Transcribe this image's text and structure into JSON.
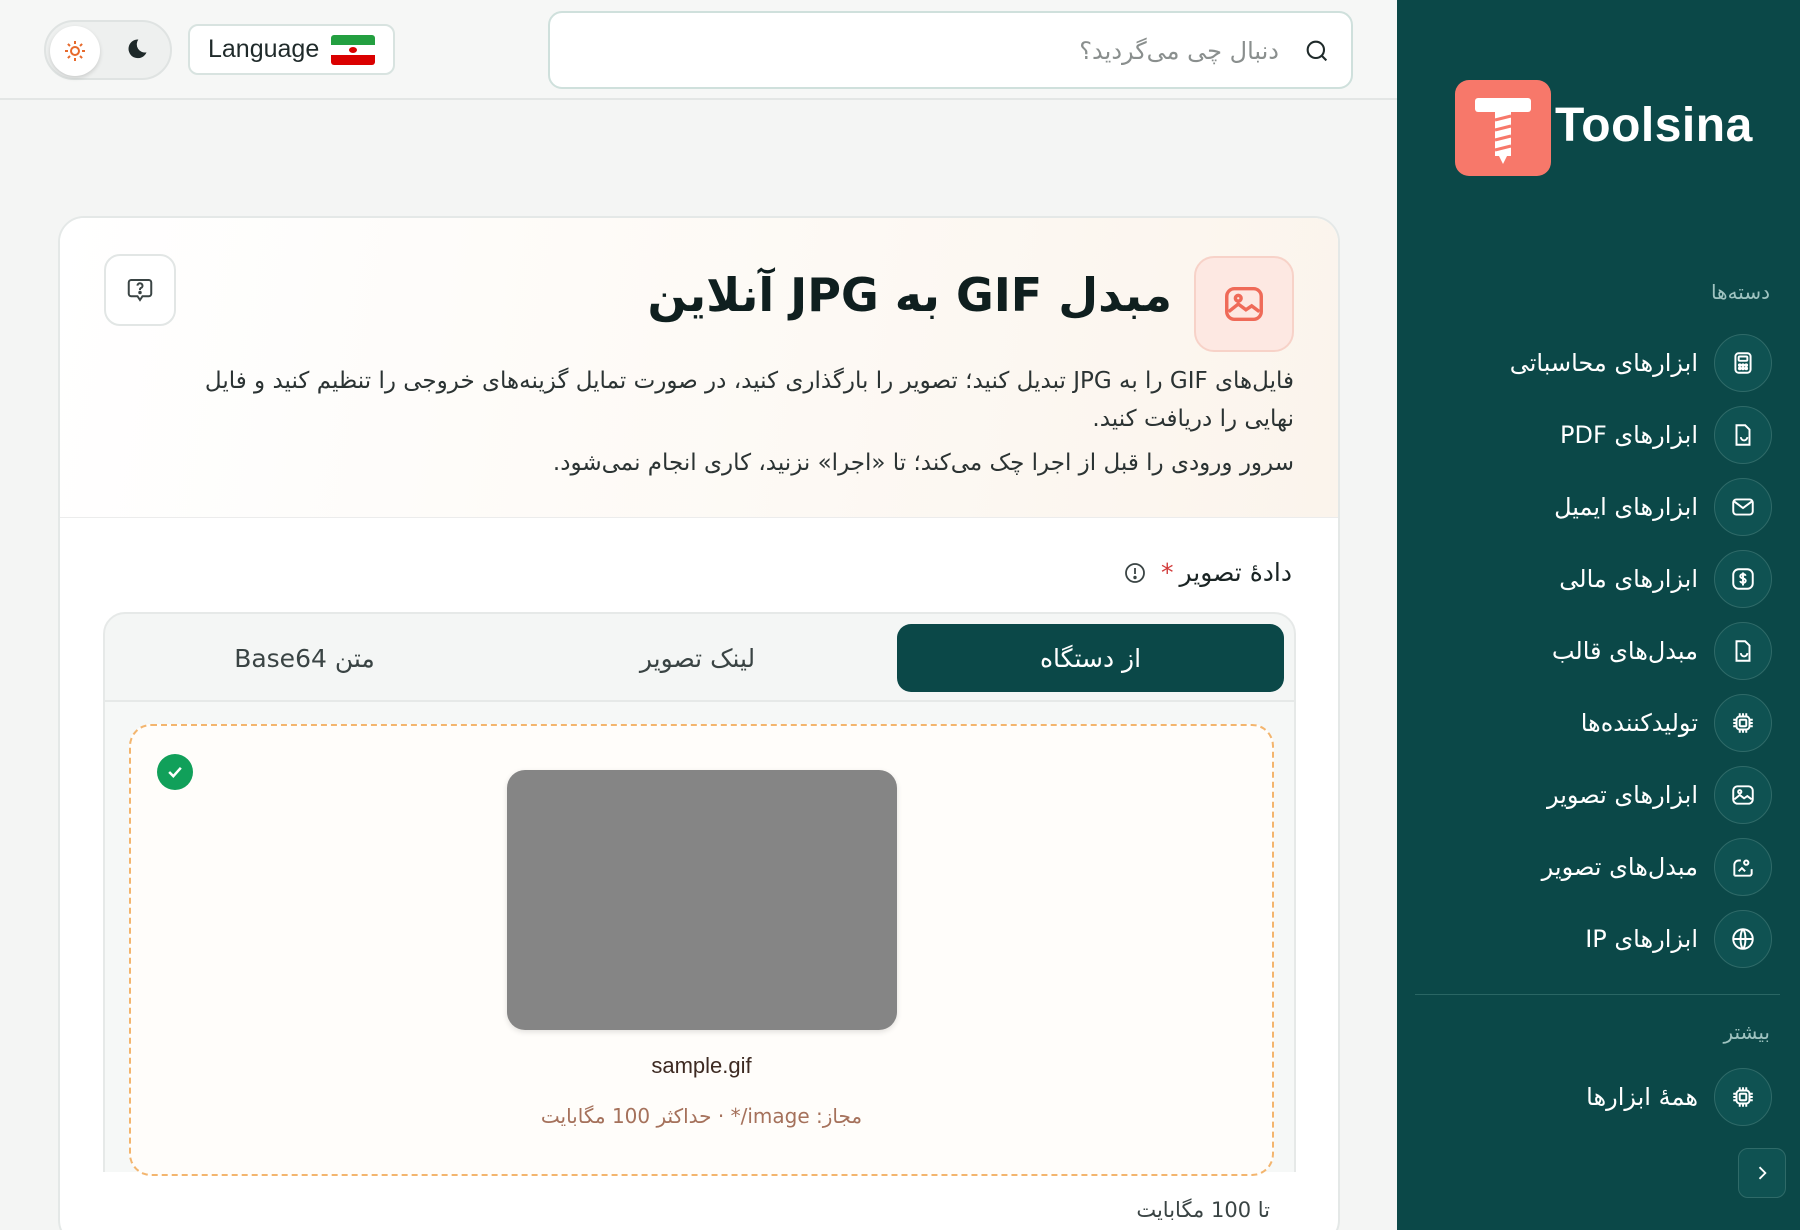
{
  "brand": {
    "name": "Toolsina",
    "accent": "#f7786a",
    "sidebar_bg": "#0b4848"
  },
  "sidebar": {
    "categories_label": "دسته‌ها",
    "items": [
      {
        "label": "ابزارهای محاسباتی",
        "icon": "calculator-icon"
      },
      {
        "label": "ابزارهای PDF",
        "icon": "pdf-file-icon"
      },
      {
        "label": "ابزارهای ایمیل",
        "icon": "mail-icon"
      },
      {
        "label": "ابزارهای مالی",
        "icon": "dollar-icon"
      },
      {
        "label": "مبدل‌های قالب",
        "icon": "file-convert-icon"
      },
      {
        "label": "تولیدکننده‌ها",
        "icon": "chip-icon"
      },
      {
        "label": "ابزارهای تصویر",
        "icon": "image-icon"
      },
      {
        "label": "مبدل‌های تصویر",
        "icon": "image-convert-icon"
      },
      {
        "label": "ابزارهای IP",
        "icon": "globe-icon"
      }
    ],
    "more_label": "بیشتر",
    "more_items": [
      {
        "label": "همهٔ ابزارها",
        "icon": "chip-icon"
      }
    ]
  },
  "topbar": {
    "search_placeholder": "دنبال چی می‌گردید؟",
    "language_label": "Language"
  },
  "page": {
    "title": "مبدل GIF به JPG آنلاین",
    "description": "فایل‌های GIF را به JPG تبدیل کنید؛ تصویر را بارگذاری کنید، در صورت تمایل گزینه‌های خروجی را تنظیم کنید و فایل نهایی را دریافت کنید.",
    "note": "سرور ورودی را قبل از اجرا چک می‌کند؛ تا «اجرا» نزنید، کاری انجام نمی‌شود."
  },
  "input": {
    "label": "دادهٔ تصویر",
    "required_mark": "*",
    "tabs": [
      {
        "label": "از دستگاه",
        "active": true
      },
      {
        "label": "لینک تصویر",
        "active": false
      },
      {
        "label": "متن Base64",
        "active": false
      }
    ],
    "file_name": "sample.gif",
    "allowed": "مجاز: image/* · حداکثر 100 مگابایت",
    "limit": "تا 100 مگابایت"
  }
}
